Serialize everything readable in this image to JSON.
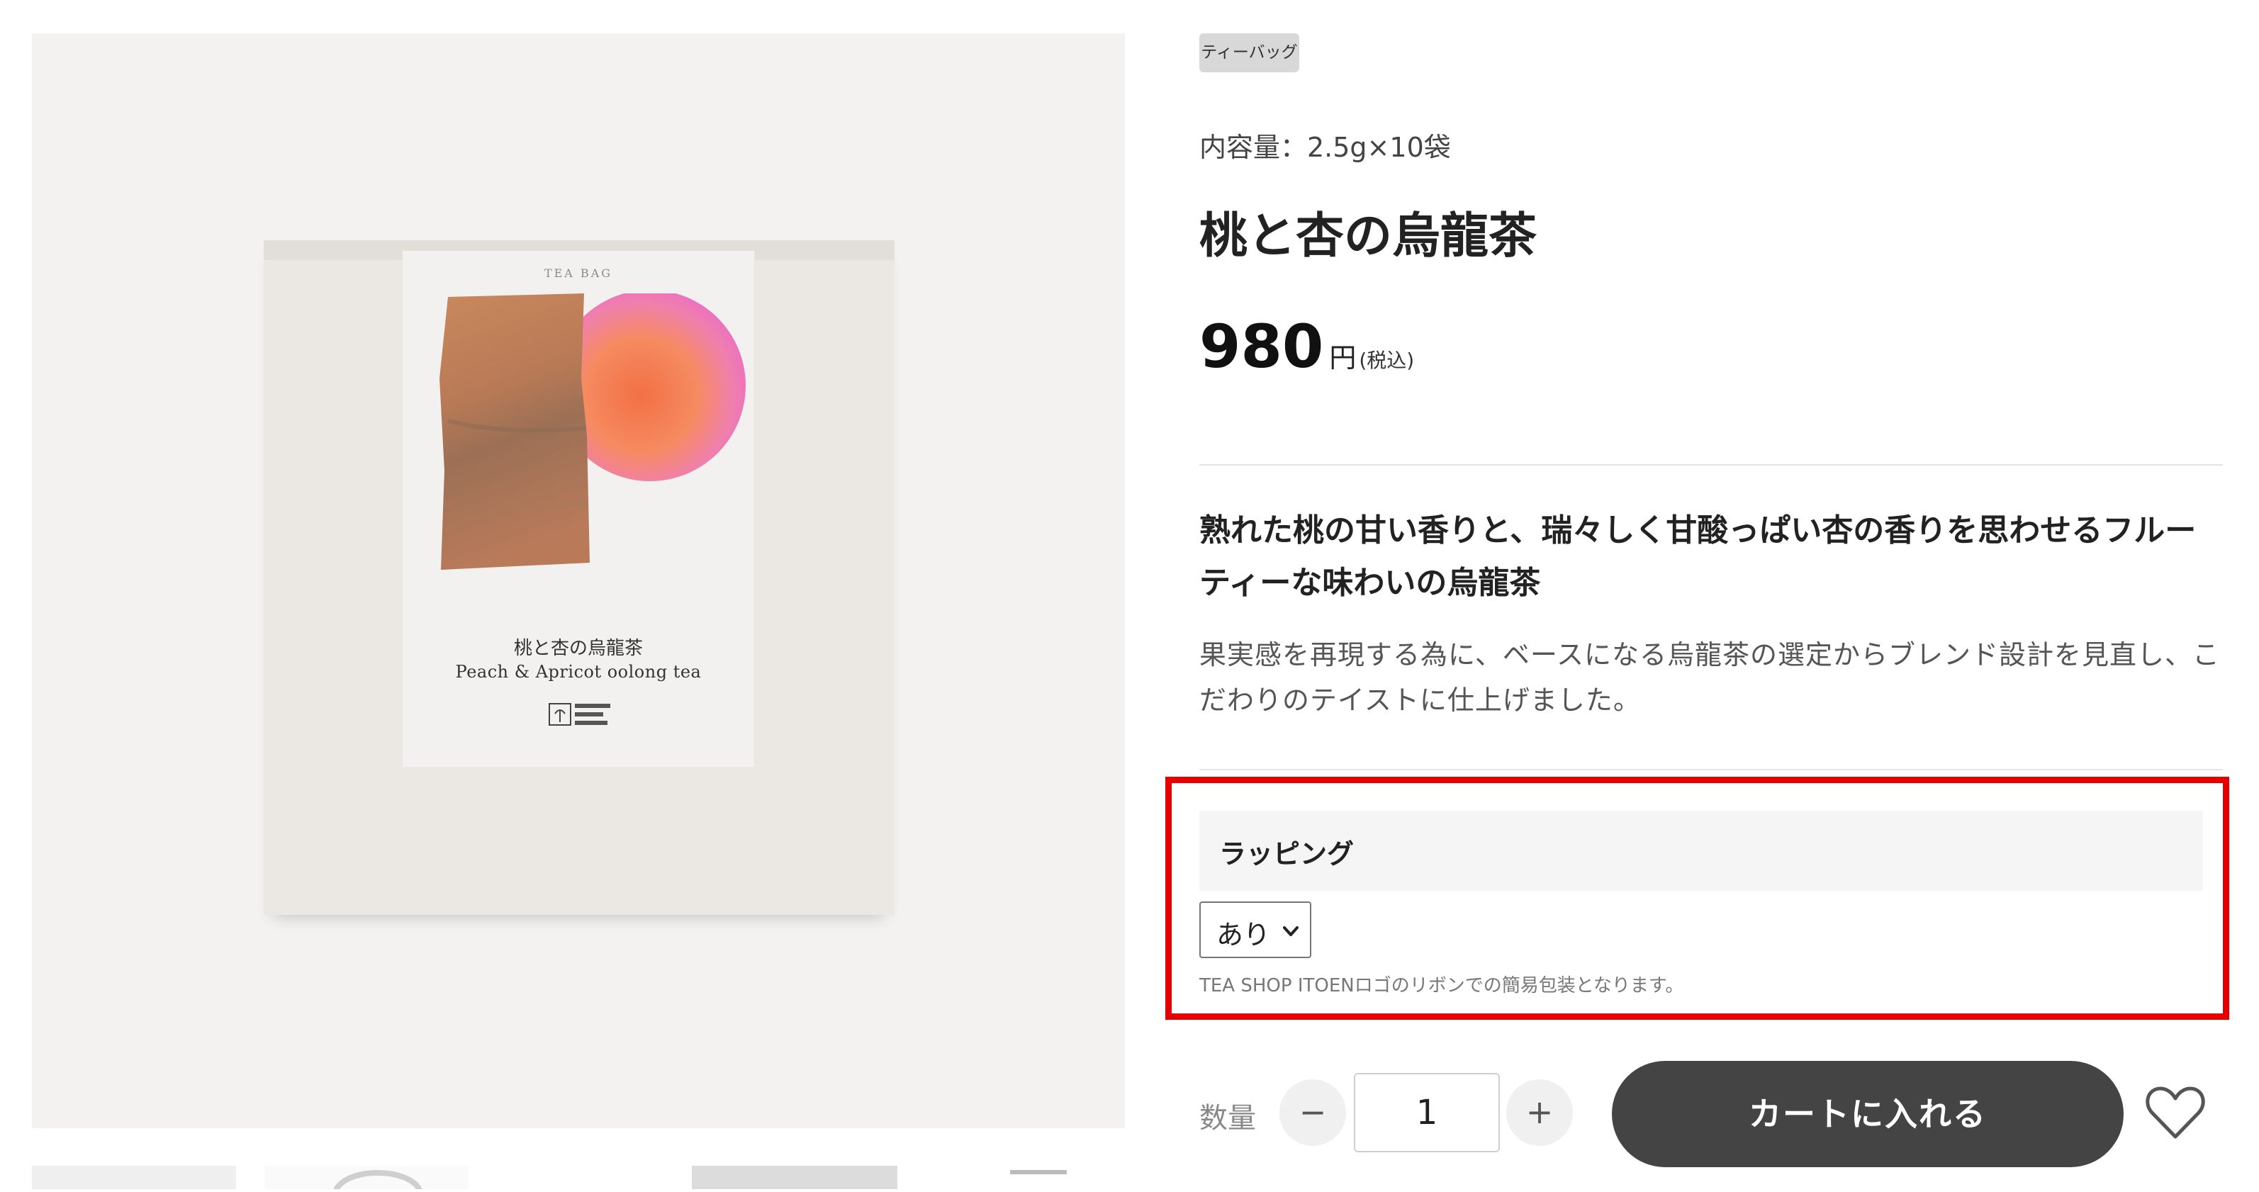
{
  "product": {
    "tag": "ティーバッグ",
    "capacity": "内容量：2.5g×10袋",
    "title": "桃と杏の烏龍茶",
    "price": "980",
    "price_unit": "円",
    "tax_note": "(税込)",
    "catchcopy": "熟れた桃の甘い香りと、瑞々しく甘酸っぱい杏の香りを思わせるフルーティーな味わいの烏龍茶",
    "description": "果実感を再現する為に、ベースになる烏龍茶の選定からブレンド設計を見直し、こだわりのテイストに仕上げました。"
  },
  "image": {
    "package_top": "TEA BAG",
    "package_name_ja": "桃と杏の烏龍茶",
    "package_name_en": "Peach & Apricot oolong tea",
    "logo_text": "TEA SHOP ITOEN"
  },
  "wrapping": {
    "heading": "ラッピング",
    "selected": "あり",
    "note": "TEA SHOP ITOENロゴのリボンでの簡易包装となります。"
  },
  "purchase": {
    "qty_label": "数量",
    "minus": "−",
    "plus": "+",
    "quantity": "1",
    "cart_button": "カートに入れる"
  },
  "icons": {
    "favorite": "heart-icon",
    "select_arrow": "chevron-down-icon"
  },
  "colors": {
    "highlight": "#e60000",
    "cart_button": "#444444",
    "tag_bg": "#d8d8d8"
  }
}
